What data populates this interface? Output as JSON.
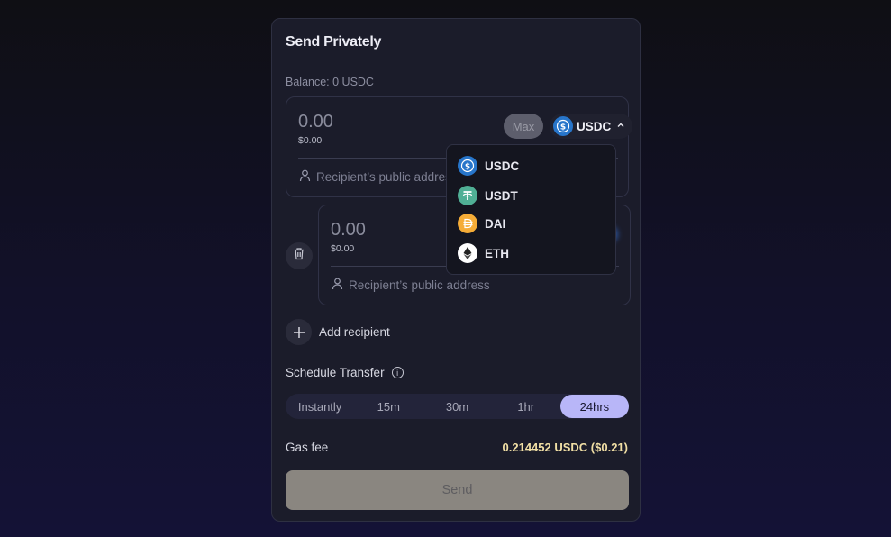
{
  "card": {
    "title": "Send Privately",
    "balance_label": "Balance: 0 USDC"
  },
  "recipients": [
    {
      "amount": "0.00",
      "usd": "$0.00",
      "address_placeholder": "Recipient’s public address"
    },
    {
      "amount": "0.00",
      "usd": "$0.00",
      "address_placeholder": "Recipient’s public address"
    }
  ],
  "max_label": "Max",
  "selected_token": {
    "symbol": "USDC",
    "icon": "usdc-icon"
  },
  "token_dropdown": [
    {
      "symbol": "USDC",
      "icon": "usdc-icon",
      "color": "#2775ca"
    },
    {
      "symbol": "USDT",
      "icon": "usdt-icon",
      "color": "#50af95"
    },
    {
      "symbol": "DAI",
      "icon": "dai-icon",
      "color": "#f5ac37"
    },
    {
      "symbol": "ETH",
      "icon": "eth-icon",
      "color": "#ffffff"
    }
  ],
  "add_recipient_label": "Add recipient",
  "schedule": {
    "label": "Schedule Transfer",
    "options": [
      "Instantly",
      "15m",
      "30m",
      "1hr",
      "24hrs"
    ],
    "selected": "24hrs"
  },
  "gas": {
    "label": "Gas fee",
    "value": "0.214452 USDC ($0.21)"
  },
  "send_label": "Send",
  "colors": {
    "accent": "#b8b6f8",
    "gas_value": "#f1dfa5",
    "send_disabled": "#8a8680"
  }
}
